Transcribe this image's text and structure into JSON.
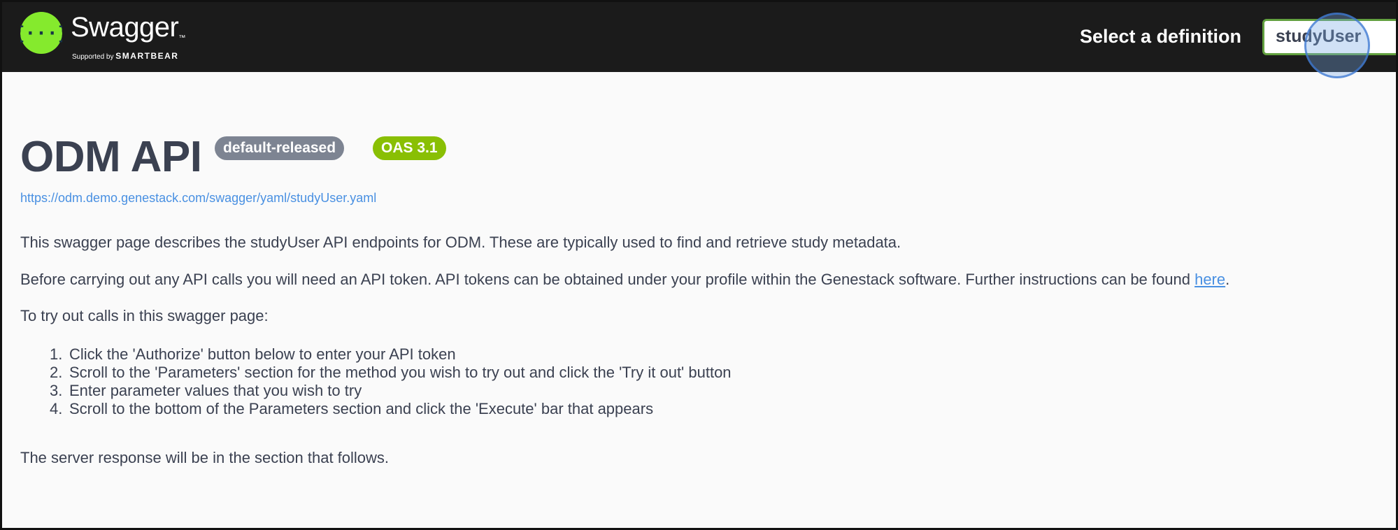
{
  "header": {
    "brand_name": "Swagger",
    "brand_tm": "™",
    "brand_supported_by": "Supported by",
    "brand_company": "SMARTBEAR",
    "logo_icon": "swagger-braces-icon",
    "select_label": "Select a definition",
    "selected_definition": "studyUser"
  },
  "info": {
    "title": "ODM API",
    "version_badge": "default-released",
    "oas_badge": "OAS 3.1",
    "spec_url": "https://odm.demo.genestack.com/swagger/yaml/studyUser.yaml",
    "paragraph_1": "This swagger page describes the studyUser API endpoints for ODM. These are typically used to find and retrieve study metadata.",
    "paragraph_2": "Before carrying out any API calls you will need an API token. API tokens can be obtained under your profile within the Genestack software. Further instructions can be found ",
    "paragraph_2_link": "here",
    "paragraph_2_end": ".",
    "paragraph_3": "To try out calls in this swagger page:",
    "steps": [
      {
        "num": "1.",
        "text": "Click the 'Authorize' button below to enter your API token"
      },
      {
        "num": "2.",
        "text": "Scroll to the 'Parameters' section for the method you wish to try out and click the 'Try it out' button"
      },
      {
        "num": "3.",
        "text": "Enter parameter values that you wish to try"
      },
      {
        "num": "4.",
        "text": "Scroll to the bottom of the Parameters section and click the 'Execute' bar that appears"
      }
    ],
    "paragraph_4": "The server response will be in the section that follows."
  },
  "colors": {
    "topbar": "#1b1b1b",
    "logo_green": "#85ea2d",
    "select_border": "#62a03f",
    "version_badge": "#7d8492",
    "oas_badge": "#89bf04",
    "link": "#4990e2",
    "text": "#3b4151"
  }
}
